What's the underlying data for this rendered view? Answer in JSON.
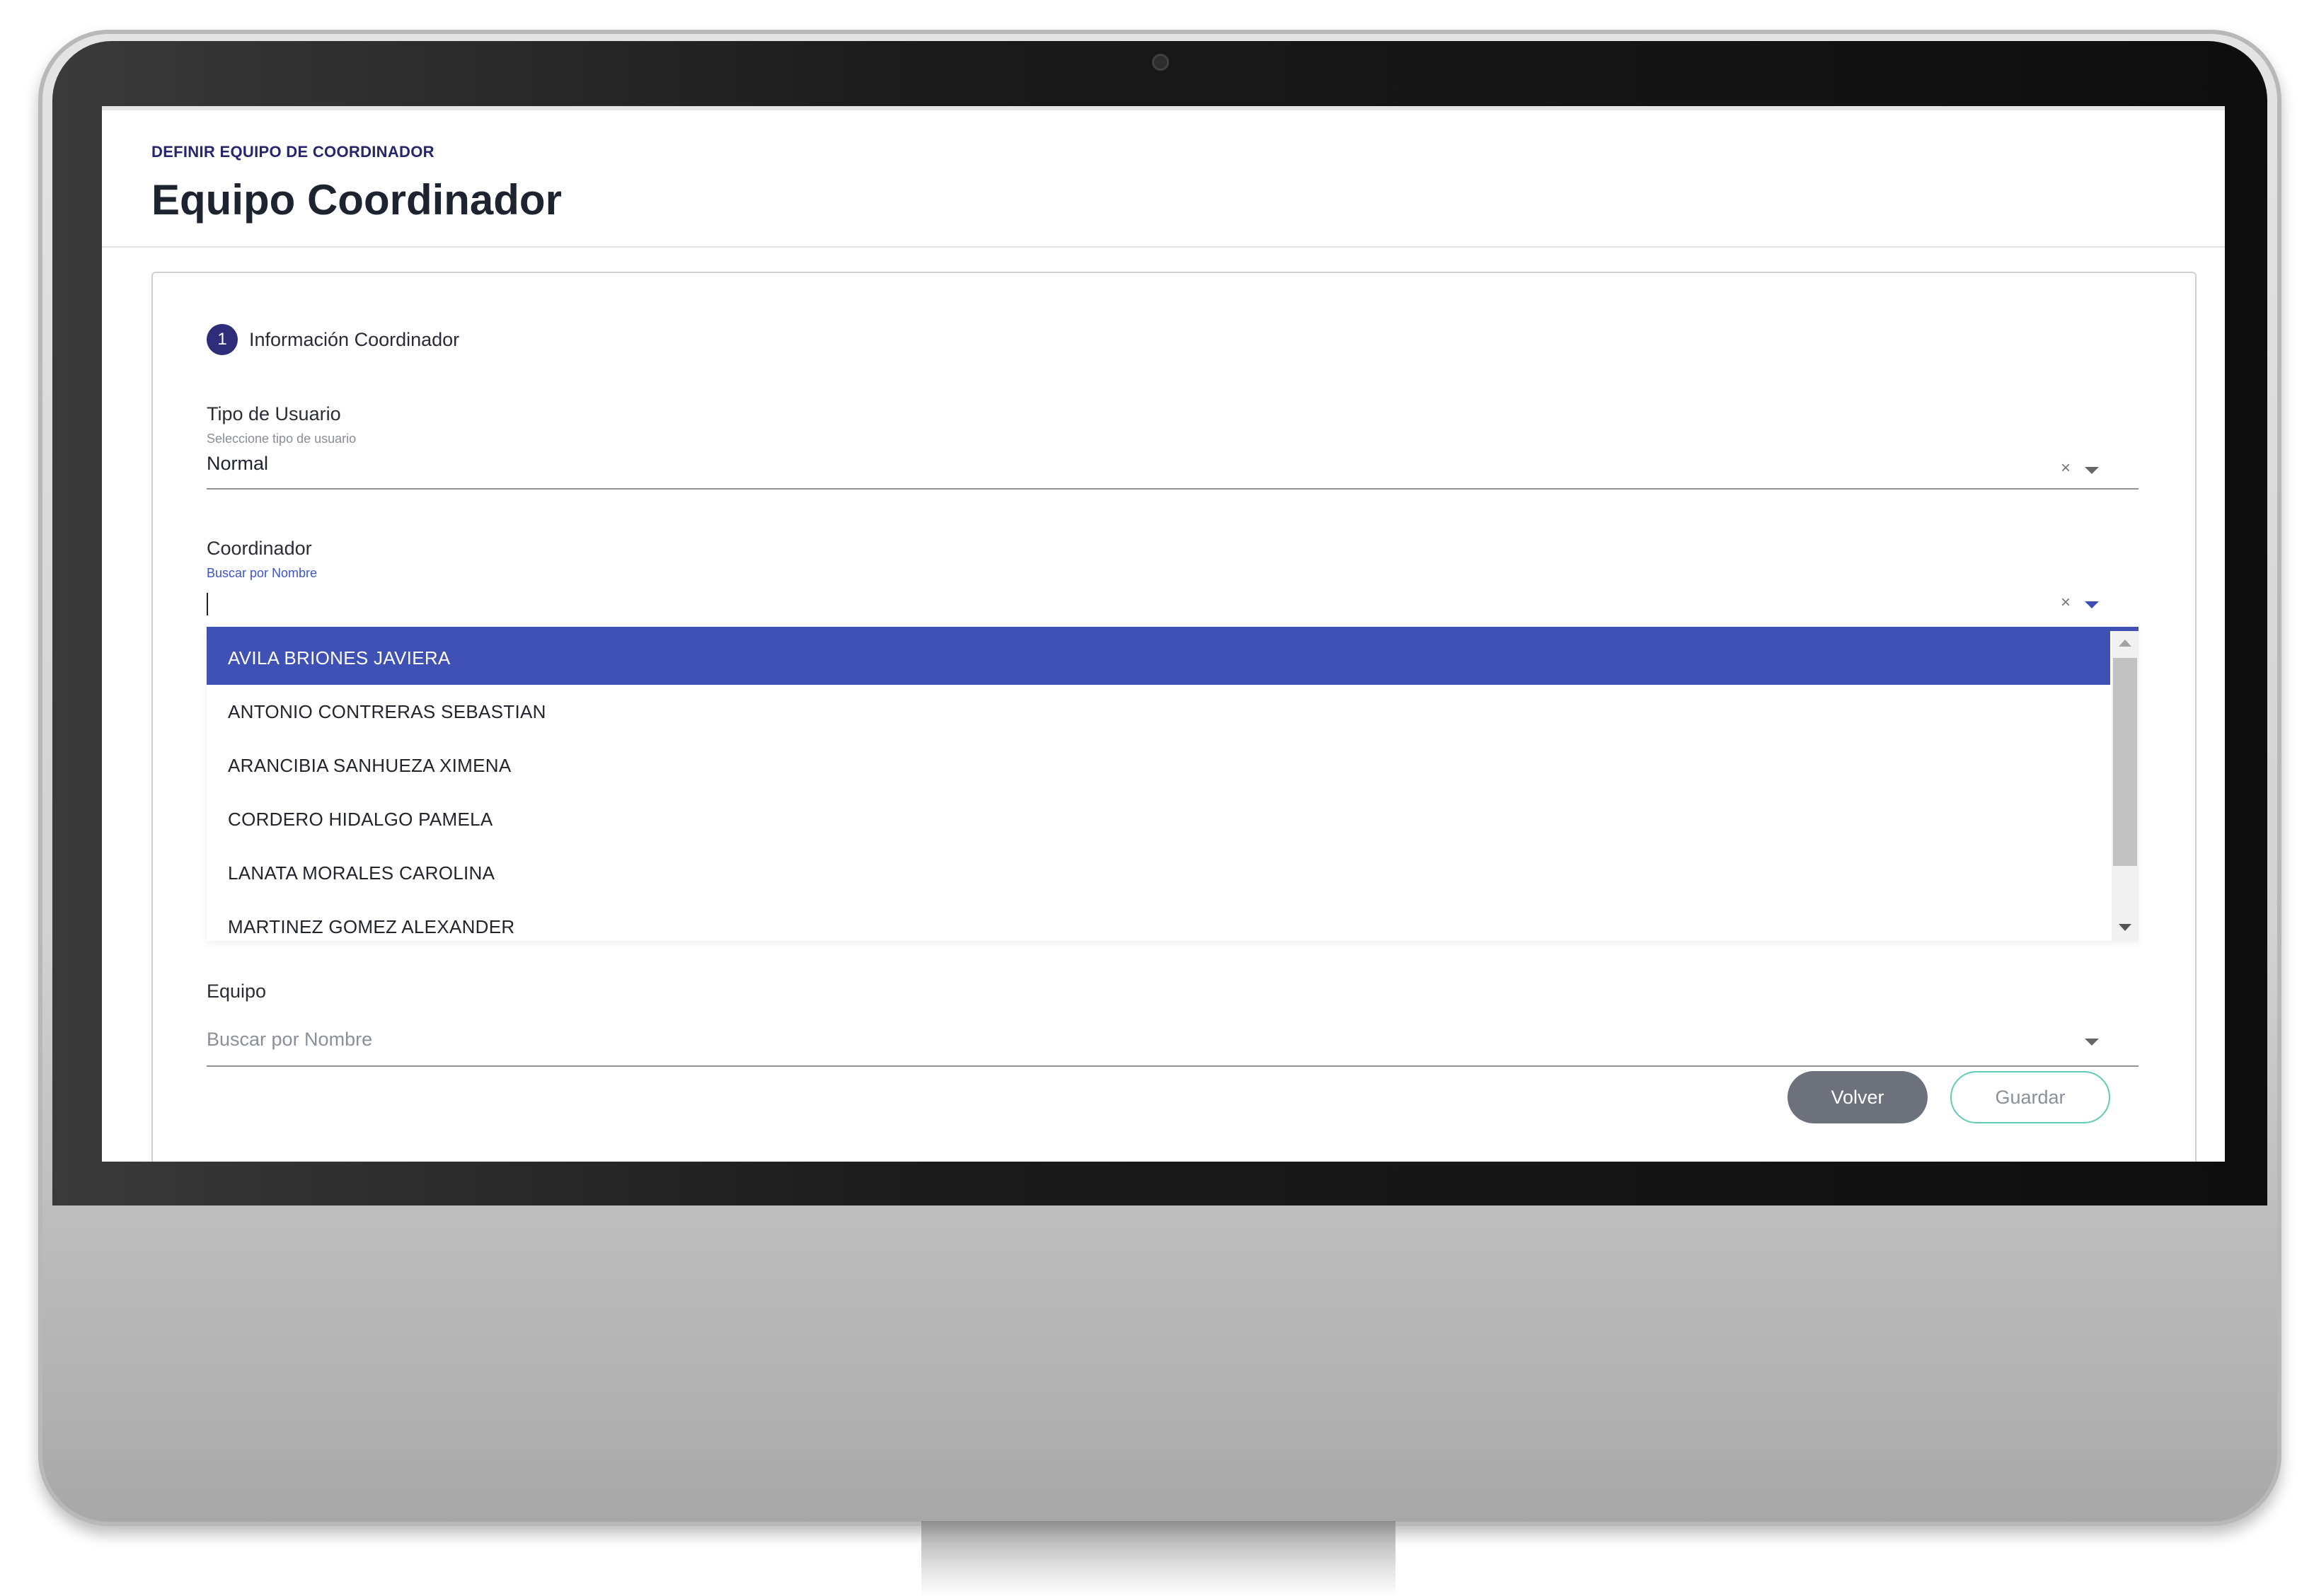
{
  "page": {
    "breadcrumb": "DEFINIR EQUIPO DE COORDINADOR",
    "title": "Equipo Coordinador"
  },
  "step": {
    "number": "1",
    "label": "Información Coordinador"
  },
  "fields": {
    "user_type": {
      "label": "Tipo de Usuario",
      "help": "Seleccione tipo de usuario",
      "value": "Normal",
      "clear_icon": "×"
    },
    "coordinator": {
      "label": "Coordinador",
      "help": "Buscar por Nombre",
      "value": "",
      "clear_icon": "×",
      "options": [
        "AVILA BRIONES JAVIERA",
        "ANTONIO CONTRERAS SEBASTIAN",
        "ARANCIBIA SANHUEZA XIMENA",
        "CORDERO HIDALGO PAMELA",
        "LANATA MORALES CAROLINA",
        "MARTINEZ GOMEZ ALEXANDER"
      ],
      "highlighted_option": "AVILA BRIONES JAVIERA"
    },
    "team": {
      "label": "Equipo",
      "placeholder": "Buscar por Nombre"
    }
  },
  "buttons": {
    "back": "Volver",
    "save": "Guardar"
  },
  "colors": {
    "accent": "#3f51b5",
    "title": "#1e2330",
    "step_badge": "#2f2d7a",
    "back_button": "#6c717c",
    "save_border": "#5fcdb5"
  }
}
